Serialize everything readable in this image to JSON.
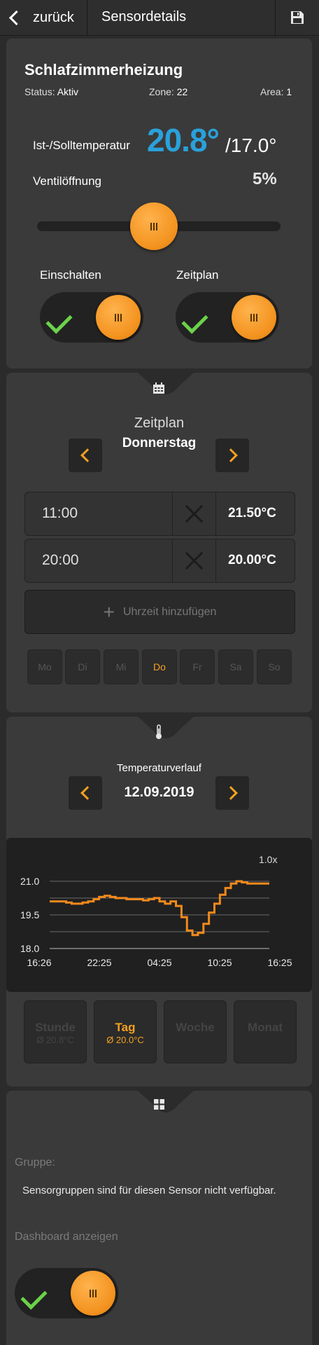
{
  "header": {
    "back_label": "zurück",
    "title": "Sensordetails",
    "save_icon": "floppy-disk-icon"
  },
  "sensor": {
    "name": "Schlafzimmerheizung",
    "status_label": "Status:",
    "status_value": "Aktiv",
    "zone_label": "Zone:",
    "zone_value": "22",
    "area_label": "Area:",
    "area_value": "1",
    "temp_label": "Ist-/Solltemperatur",
    "ist": "20.8°",
    "soll": "/17.0°",
    "valve_label": "Ventilöffnung",
    "valve_value": "5%",
    "valve_fraction": 0.5,
    "toggle_switch_label": "Einschalten",
    "toggle_switch_on": true,
    "toggle_schedule_label": "Zeitplan",
    "toggle_schedule_on": true
  },
  "schedule": {
    "icon": "calendar-icon",
    "title": "Zeitplan",
    "day": "Donnerstag",
    "slots": [
      {
        "time": "11:00",
        "temp": "21.50°C"
      },
      {
        "time": "20:00",
        "temp": "20.00°C"
      }
    ],
    "add_label": "Uhrzeit hinzufügen",
    "days": [
      "Mo",
      "Di",
      "Mi",
      "Do",
      "Fr",
      "Sa",
      "So"
    ],
    "active_day": "Do"
  },
  "history": {
    "icon": "thermometer-icon",
    "title": "Temperaturverlauf",
    "date": "12.09.2019",
    "zoom": "1.0x",
    "ranges": [
      {
        "name": "Stunde",
        "avg": "Ø 20.8°C"
      },
      {
        "name": "Tag",
        "avg": "Ø 20.0°C"
      },
      {
        "name": "Woche",
        "avg": ""
      },
      {
        "name": "Monat",
        "avg": ""
      }
    ],
    "active_range": "Tag"
  },
  "chart_data": {
    "type": "line",
    "x_ticks": [
      "16:26",
      "22:25",
      "04:25",
      "10:25",
      "16:25"
    ],
    "y_ticks": [
      "21.0",
      "19.5",
      "18.0"
    ],
    "ylim": [
      18.0,
      21.0
    ],
    "color": "#f28a1c",
    "series": [
      {
        "values": [
          [
            0,
            20.1
          ],
          [
            1,
            20.1
          ],
          [
            2,
            20.1
          ],
          [
            3,
            20.05
          ],
          [
            4,
            20.0
          ],
          [
            5,
            20.0
          ],
          [
            6,
            20.05
          ],
          [
            7,
            20.1
          ],
          [
            8,
            20.2
          ],
          [
            9,
            20.3
          ],
          [
            10,
            20.35
          ],
          [
            11,
            20.3
          ],
          [
            12,
            20.25
          ],
          [
            13,
            20.25
          ],
          [
            14,
            20.2
          ],
          [
            15,
            20.2
          ],
          [
            16,
            20.2
          ],
          [
            17,
            20.15
          ],
          [
            18,
            20.2
          ],
          [
            19,
            20.25
          ],
          [
            20,
            20.1
          ],
          [
            21,
            20.0
          ],
          [
            22,
            20.1
          ],
          [
            23,
            19.9
          ],
          [
            24,
            19.4
          ],
          [
            25,
            18.8
          ],
          [
            26,
            18.6
          ],
          [
            27,
            18.7
          ],
          [
            28,
            19.1
          ],
          [
            29,
            19.6
          ],
          [
            30,
            20.0
          ],
          [
            31,
            20.4
          ],
          [
            32,
            20.7
          ],
          [
            33,
            20.9
          ],
          [
            34,
            21.0
          ],
          [
            35,
            20.95
          ],
          [
            36,
            20.9
          ],
          [
            37,
            20.9
          ],
          [
            38,
            20.9
          ],
          [
            39,
            20.9
          ],
          [
            40,
            20.9
          ]
        ]
      }
    ]
  },
  "group": {
    "icon": "grid-icon",
    "label": "Gruppe:",
    "text": "Sensorgruppen sind für diesen Sensor nicht verfügbar.",
    "dashboard_label": "Dashboard anzeigen",
    "dashboard_on": true
  }
}
